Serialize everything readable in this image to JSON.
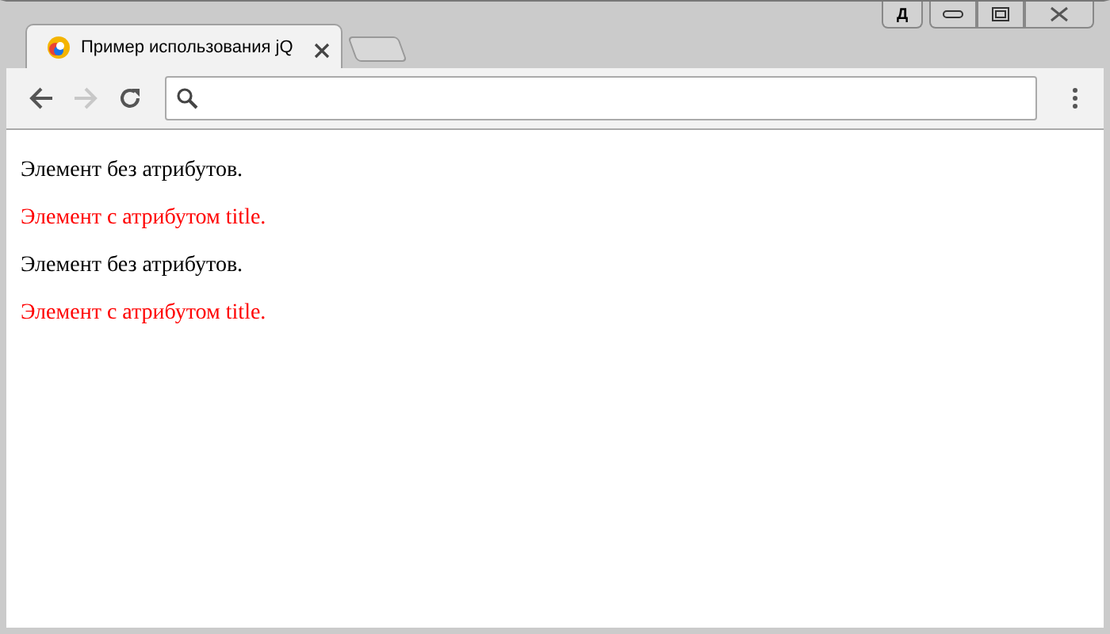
{
  "window": {
    "lang_button": "Д"
  },
  "tab": {
    "title": "Пример использования jQ",
    "selected": true
  },
  "toolbar": {
    "back_disabled": false,
    "forward_disabled": true
  },
  "paragraphs": [
    {
      "text": "Элемент без атрибутов.",
      "color": "#000000"
    },
    {
      "text": "Элемент с атрибутом title.",
      "color": "#ff0000"
    },
    {
      "text": "Элемент без атрибутов.",
      "color": "#000000"
    },
    {
      "text": "Элемент с атрибутом title.",
      "color": "#ff0000"
    }
  ]
}
